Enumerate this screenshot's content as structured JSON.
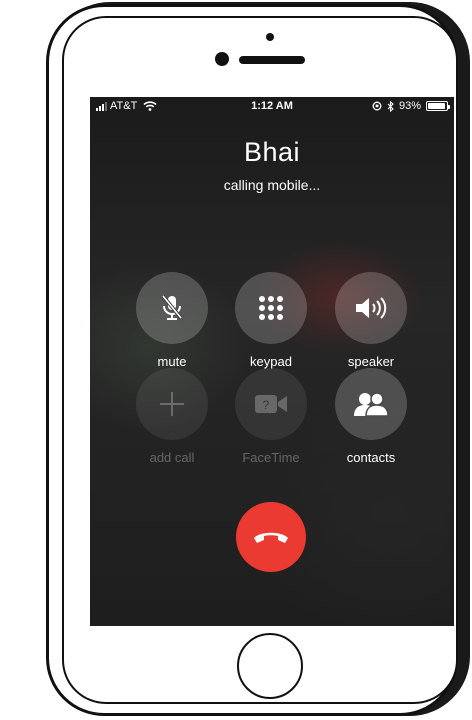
{
  "status_bar": {
    "carrier": "AT&T",
    "time": "1:12 AM",
    "battery_percent_text": "93%",
    "battery_level": 0.93
  },
  "call": {
    "caller_name": "Bhai",
    "status": "calling mobile..."
  },
  "controls": [
    {
      "label": "mute",
      "icon": "microphone-slash-icon",
      "enabled": true
    },
    {
      "label": "keypad",
      "icon": "keypad-icon",
      "enabled": true
    },
    {
      "label": "speaker",
      "icon": "speaker-icon",
      "enabled": true
    },
    {
      "label": "add call",
      "icon": "plus-icon",
      "enabled": false
    },
    {
      "label": "FaceTime",
      "icon": "facetime-icon",
      "enabled": false
    },
    {
      "label": "contacts",
      "icon": "contacts-icon",
      "enabled": true
    }
  ],
  "end_call": {
    "icon": "phone-hangup-icon",
    "color": "#ea3a32"
  }
}
